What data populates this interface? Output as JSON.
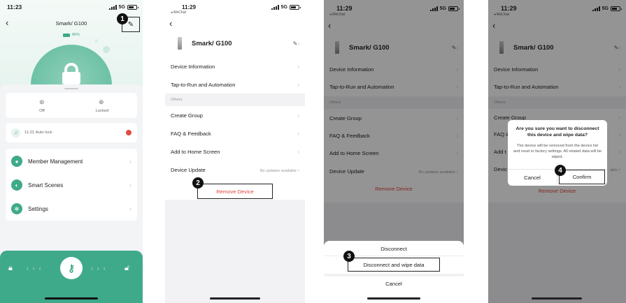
{
  "screen1": {
    "time": "11:23",
    "title": "Smark/ G100",
    "battery": "86%",
    "signal": "5G",
    "status_items": [
      {
        "label": "Off",
        "icon": "settings-icon"
      },
      {
        "label": "Locked",
        "icon": "lock-icon"
      }
    ],
    "log": {
      "time": "11:22",
      "text": "Auto lock",
      "icon": "bell-icon"
    },
    "menu": [
      {
        "label": "Member Management",
        "icon": "person-icon"
      },
      {
        "label": "Smart Scenes",
        "icon": "toggle-icon"
      },
      {
        "label": "Settings",
        "icon": "gear-icon"
      }
    ],
    "step_marker": "1",
    "accent": "#3faa8a"
  },
  "screen2": {
    "time": "11:29",
    "wechat": "◂ WeChat",
    "signal": "5G",
    "device_name": "Smark/ G100",
    "rows": [
      {
        "label": "Device Information",
        "value": ""
      },
      {
        "label": "Tap-to-Run and Automation",
        "value": ""
      }
    ],
    "section_header": "Others",
    "others": [
      {
        "label": "Create Group",
        "value": ""
      },
      {
        "label": "FAQ & Feedback",
        "value": ""
      },
      {
        "label": "Add to Home Screen",
        "value": ""
      },
      {
        "label": "Device Update",
        "value": "No updates available"
      }
    ],
    "remove_label": "Remove Device",
    "step_marker": "2",
    "danger_color": "#e0453d"
  },
  "screen3": {
    "time": "11:29",
    "wechat": "◂ WeChat",
    "signal": "5G",
    "device_name": "Smark/ G100",
    "rows": [
      {
        "label": "Device Information",
        "value": ""
      },
      {
        "label": "Tap-to-Run and Automation",
        "value": ""
      }
    ],
    "section_header": "Others",
    "others": [
      {
        "label": "Create Group",
        "value": ""
      },
      {
        "label": "FAQ & Feedback",
        "value": ""
      },
      {
        "label": "Add to Home Screen",
        "value": ""
      },
      {
        "label": "Device Update",
        "value": "No updates available"
      }
    ],
    "remove_label": "Remove Device",
    "sheet": {
      "option1": "Disconnect",
      "option2": "Disconnect and wipe data",
      "cancel": "Cancel"
    },
    "step_marker": "3"
  },
  "screen4": {
    "time": "11:29",
    "wechat": "◂ WeChat",
    "signal": "5G",
    "device_name": "Smark/ G100",
    "rows": [
      {
        "label": "Device Information",
        "value": ""
      },
      {
        "label": "Tap-to-Run and Automation",
        "value": ""
      }
    ],
    "section_header": "Others",
    "others_visible": [
      "Create Group",
      "FAQ &",
      "Add t",
      "Devic"
    ],
    "others_right": [
      "",
      "",
      "",
      "able"
    ],
    "remove_label": "Remove Device",
    "dialog": {
      "title": "Are you sure you want to disconnect this device and wipe data?",
      "body": "The device will be removed from the device list and reset to factory settings. All related data will be wiped.",
      "cancel": "Cancel",
      "confirm": "Confirm"
    },
    "step_marker": "4"
  }
}
